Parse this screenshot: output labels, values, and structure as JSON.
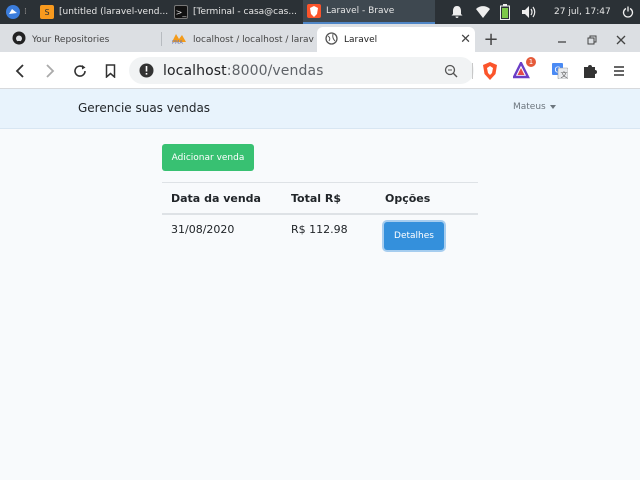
{
  "taskbar": {
    "tasks": [
      {
        "label": "[untitled (laravel-vend..."
      },
      {
        "label": "[Terminal - casa@cas..."
      },
      {
        "label": "Laravel - Brave"
      }
    ],
    "clock": "27 jul, 17:47"
  },
  "browser": {
    "tabs": [
      {
        "label": "Your Repositories"
      },
      {
        "label": "localhost / localhost / larav"
      },
      {
        "label": "Laravel"
      }
    ],
    "url_host": "localhost",
    "url_path": ":8000/vendas",
    "badge_count": "1"
  },
  "page": {
    "brand": "Gerencie suas vendas",
    "user": "Mateus",
    "add_button": "Adicionar venda",
    "table": {
      "headers": [
        "Data da venda",
        "Total R$",
        "Opções"
      ],
      "rows": [
        {
          "date": "31/08/2020",
          "total": "R$ 112.98",
          "action": "Detalhes"
        }
      ]
    }
  },
  "colors": {
    "nav_bg": "#e8f3fc",
    "success": "#38c172",
    "primary": "#3490dc",
    "taskbar": "#2b3136"
  }
}
